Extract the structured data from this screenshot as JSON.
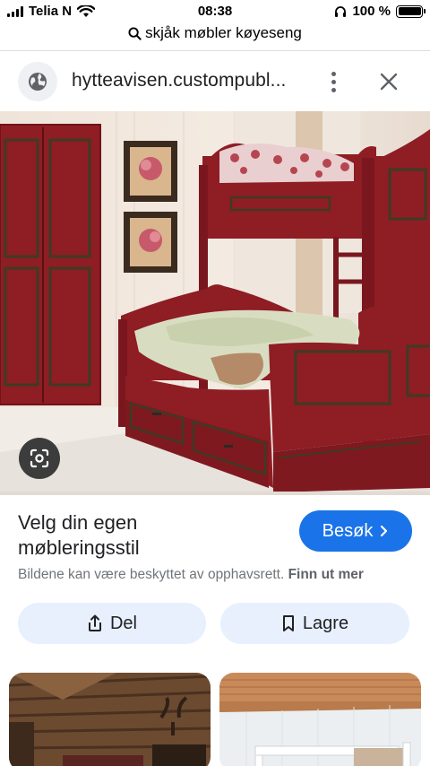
{
  "status_bar": {
    "carrier": "Telia N",
    "time": "08:38",
    "battery": "100 %",
    "icons": [
      "signal-icon",
      "wifi-icon",
      "headphones-icon",
      "battery-icon"
    ]
  },
  "search": {
    "query": "skjåk møbler køyeseng",
    "icon": "search-icon"
  },
  "site": {
    "url": "hytteavisen.custompubl...",
    "icons": [
      "globe-icon",
      "more-vert-icon",
      "close-icon"
    ]
  },
  "result": {
    "title_line1": "Velg din egen",
    "title_line2": "møbleringsstil",
    "visit_label": "Besøk",
    "copyright_text": "Bildene kan være beskyttet av opphavsrett.",
    "learn_more": "Finn ut mer"
  },
  "actions": {
    "share_label": "Del",
    "save_label": "Lagre"
  },
  "colors": {
    "accent": "#1a73e8",
    "pill_bg": "#e8f0fe",
    "furniture_red": "#8e1d24"
  }
}
